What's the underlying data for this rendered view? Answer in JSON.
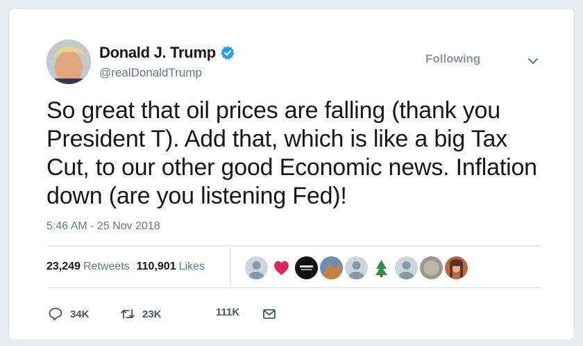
{
  "user": {
    "display_name": "Donald J. Trump",
    "handle": "@realDonaldTrump",
    "follow_label": "Following",
    "verified": true
  },
  "tweet": {
    "text": "So great that oil prices are falling (thank you President T). Add that, which is like a big Tax Cut, to our other good Economic news. Inflation down (are you listening Fed)!",
    "timestamp": "5:46 AM - 25 Nov 2018"
  },
  "stats": {
    "retweets_count": "23,249",
    "retweets_label": "Retweets",
    "likes_count": "110,901",
    "likes_label": "Likes"
  },
  "actions": {
    "replies": "34K",
    "retweets": "23K",
    "likes": "111K"
  },
  "icons": {
    "verified": "verified-badge-icon",
    "caret": "chevron-down-icon",
    "reply": "reply-icon",
    "retweet": "retweet-icon",
    "message": "envelope-icon"
  },
  "colors": {
    "verified_blue": "#1da1f2",
    "text_primary": "#14171a",
    "text_secondary": "#657786",
    "heart_red": "#e0245e"
  }
}
